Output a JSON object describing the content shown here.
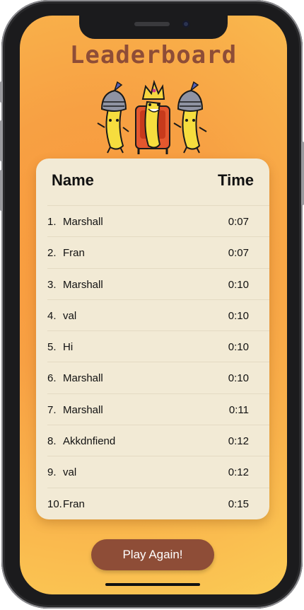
{
  "app": {
    "title": "Leaderboard"
  },
  "leaderboard": {
    "header_name": "Name",
    "header_time": "Time",
    "entries": [
      {
        "rank": "1.",
        "name": "Marshall",
        "time": "0:07"
      },
      {
        "rank": "2.",
        "name": "Fran",
        "time": "0:07"
      },
      {
        "rank": "3.",
        "name": "Marshall",
        "time": "0:10"
      },
      {
        "rank": "4.",
        "name": "val",
        "time": "0:10"
      },
      {
        "rank": "5.",
        "name": "Hi",
        "time": "0:10"
      },
      {
        "rank": "6.",
        "name": "Marshall",
        "time": "0:10"
      },
      {
        "rank": "7.",
        "name": "Marshall",
        "time": "0:11"
      },
      {
        "rank": "8.",
        "name": "Akkdnfiend",
        "time": "0:12"
      },
      {
        "rank": "9.",
        "name": "val",
        "time": "0:12"
      },
      {
        "rank": "10.",
        "name": "Fran",
        "time": "0:15"
      }
    ]
  },
  "actions": {
    "play_again_label": "Play Again!"
  },
  "theme": {
    "accent": "#8e4d37",
    "card_bg": "#f2ead5",
    "bg_orange": "#f99a3c",
    "bg_yellow": "#fbcb55"
  },
  "icons": {
    "mascot": "banana-king-with-knights-illustration"
  }
}
